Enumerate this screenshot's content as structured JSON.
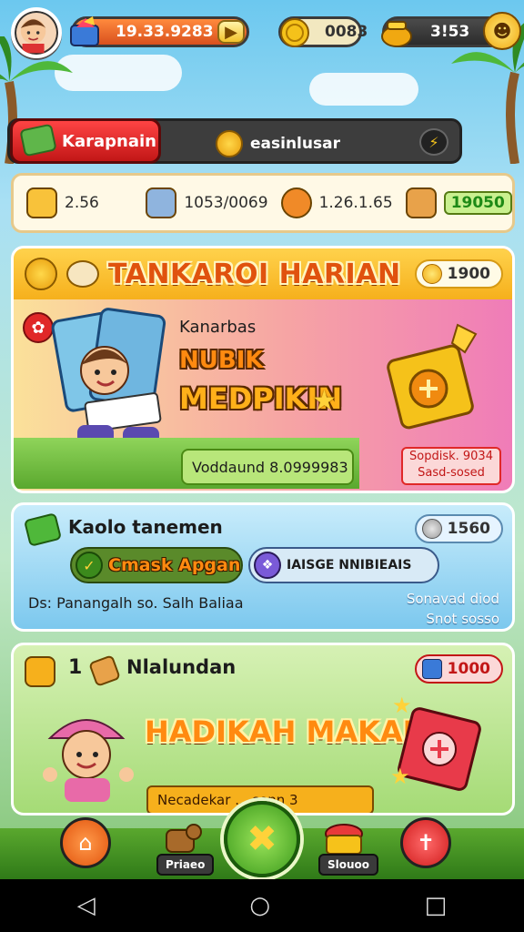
{
  "topbar": {
    "gems": "19.33.9283",
    "coins": "0083",
    "energy": "3!53",
    "plus": "+"
  },
  "subbar": {
    "campaign": "Karapnain",
    "center": "easinlusar"
  },
  "stats": [
    {
      "icon": "cheese-icon",
      "value": "2.56"
    },
    {
      "icon": "bucket-icon",
      "value": "1053/0069"
    },
    {
      "icon": "pot-icon",
      "value": "1.26.1.65"
    },
    {
      "icon": "hand-icon",
      "value": "19050"
    }
  ],
  "card1": {
    "title": "TANKAROI HARIAN",
    "badge": "1900",
    "line1": "Kanarbas",
    "line2": "NUBIK",
    "line3": "MEDPIKIN",
    "progress": "Voddaund 8.0999983",
    "right_label_1": "Sopdisk. 9034",
    "right_label_2": "Sasd-sosed"
  },
  "card2": {
    "title": "Kaolo tanemen",
    "badge": "1560",
    "option1": "Cmask Apgan",
    "option2": "IAISGE NNIBIEAIS",
    "footer": "Ds: Panangalh so. Salh Baliaa",
    "right_label_1": "Sonavad diod",
    "right_label_2": "Snot sosso"
  },
  "card3": {
    "count": "1",
    "title": "Nlalundan",
    "badge": "1000",
    "headline": "HADIKAH MAKAII!",
    "footer": "Necadekar ... sonn 3"
  },
  "nav": {
    "left2": "Priaeo",
    "right2": "Slouoo"
  },
  "colors": {
    "accent": "#f6b01c",
    "danger": "#e02828",
    "success": "#3b9a1c"
  }
}
